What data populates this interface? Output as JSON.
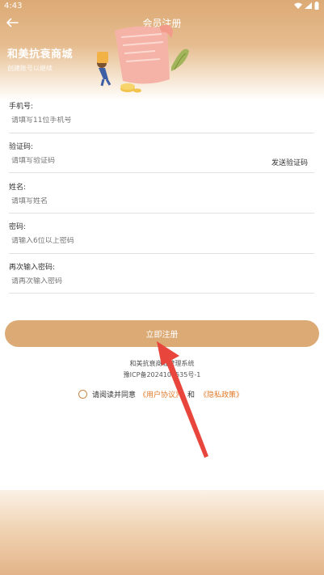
{
  "status_bar": {
    "time": "4:43"
  },
  "nav": {
    "title": "会员注册"
  },
  "brand": {
    "name": "和美抗衰商城",
    "subtitle": "创建账号以继续"
  },
  "fields": [
    {
      "label": "手机号:",
      "placeholder": "请填写11位手机号"
    },
    {
      "label": "验证码:",
      "placeholder": "请填写验证码",
      "action": "发送验证码"
    },
    {
      "label": "姓名:",
      "placeholder": "请填写姓名"
    },
    {
      "label": "密码:",
      "placeholder": "请输入6位以上密码"
    },
    {
      "label": "再次输入密码:",
      "placeholder": "请再次输入密码"
    }
  ],
  "submit": {
    "label": "立即注册"
  },
  "footer": {
    "line1": "和美抗衰商城管理系统",
    "line2": "豫ICP备2024105535号-1"
  },
  "agreement": {
    "prefix": "请阅读并同意",
    "user_agreement": "《用户协议》",
    "and": "和",
    "privacy_policy": "《隐私政策》"
  },
  "colors": {
    "accent": "#dcaa75",
    "link": "#e07a2a",
    "arrow": "#e8463c"
  }
}
